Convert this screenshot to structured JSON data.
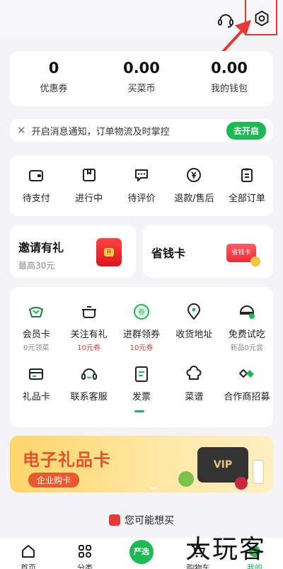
{
  "stats": [
    {
      "value": "0",
      "label": "优惠券"
    },
    {
      "value": "0.00",
      "label": "买菜币"
    },
    {
      "value": "0.00",
      "label": "我的钱包"
    }
  ],
  "notice": {
    "close": "✕",
    "text": "开启消息通知，订单物流及时掌控",
    "button": "去开启"
  },
  "orders": [
    {
      "label": "待支付",
      "icon": "wallet-icon"
    },
    {
      "label": "进行中",
      "icon": "package-icon"
    },
    {
      "label": "待评价",
      "icon": "comment-icon"
    },
    {
      "label": "退款/售后",
      "icon": "refund-icon"
    },
    {
      "label": "全部订单",
      "icon": "clipboard-icon"
    }
  ],
  "promos": {
    "invite": {
      "title": "邀请有礼",
      "subtitle": "最高30元",
      "badge": "开"
    },
    "save": {
      "title": "省钱卡",
      "badge": "省钱卡"
    }
  },
  "services_row1": [
    {
      "label": "会员卡",
      "sub": "0元领菜",
      "icon": "member-icon"
    },
    {
      "label": "关注有礼",
      "sub": "10元券",
      "icon": "pot-icon"
    },
    {
      "label": "进群领券",
      "sub": "10元券",
      "icon": "coupon-icon"
    },
    {
      "label": "收货地址",
      "sub": "",
      "icon": "location-icon"
    },
    {
      "label": "免费试吃",
      "sub": "新品0元尝",
      "icon": "taste-icon"
    }
  ],
  "services_row2": [
    {
      "label": "礼品卡",
      "icon": "giftcard-icon"
    },
    {
      "label": "联系客服",
      "icon": "headset-icon"
    },
    {
      "label": "发票",
      "icon": "invoice-icon"
    },
    {
      "label": "菜谱",
      "icon": "chef-icon"
    },
    {
      "label": "合作商招募",
      "icon": "handshake-icon"
    }
  ],
  "banner": {
    "title": "电子礼品卡",
    "tag": "企业购卡",
    "card": "VIP"
  },
  "may_like": "您可能想买",
  "tabs": [
    {
      "label": "首页"
    },
    {
      "label": "分类"
    },
    {
      "label": "严选"
    },
    {
      "label": "购物车"
    },
    {
      "label": "我的"
    }
  ],
  "watermark": "大玩客",
  "colors": {
    "accent": "#1db954",
    "highlight": "#e53935",
    "banner_text": "#e4522b"
  }
}
